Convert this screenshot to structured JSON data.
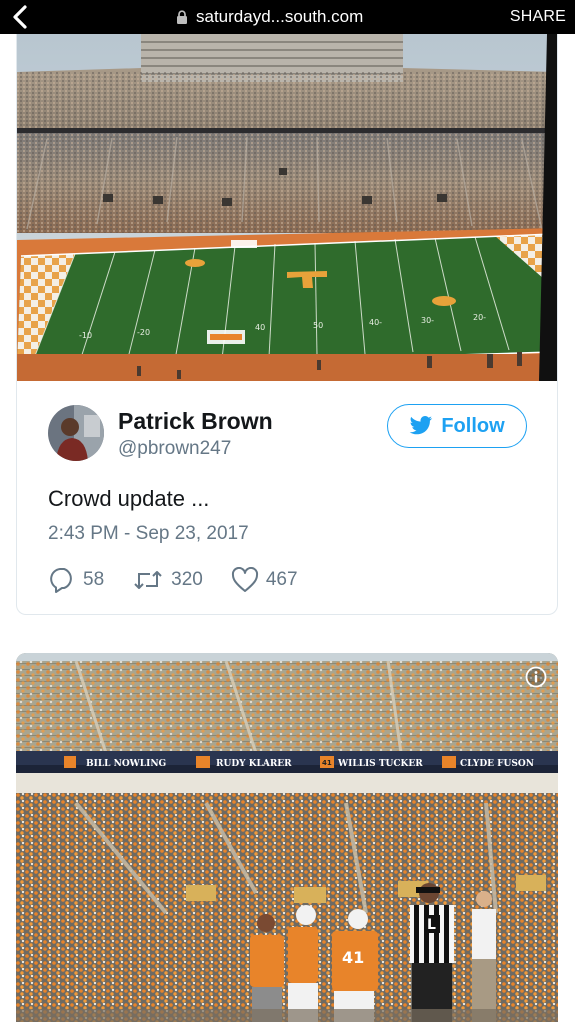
{
  "browser": {
    "url": "saturdayd...south.com",
    "share_label": "SHARE"
  },
  "tweet": {
    "user_name": "Patrick Brown",
    "user_handle": "@pbrown247",
    "follow_label": "Follow",
    "text": "Crowd update ...",
    "timestamp": "2:43 PM - Sep 23, 2017",
    "reply_count": "58",
    "retweet_count": "320",
    "like_count": "467"
  },
  "stadium_photo": {
    "yard_numbers": [
      "-10",
      "-20",
      "40",
      "50",
      "40-",
      "30-",
      "20-"
    ]
  },
  "crowd_photo": {
    "ring_of_honor": [
      {
        "number": "",
        "name": "BILL NOWLING"
      },
      {
        "number": "",
        "name": "RUDY KLARER"
      },
      {
        "number": "41",
        "name": "WILLIS TUCKER"
      },
      {
        "number": "",
        "name": "CLYDE FUSON"
      }
    ],
    "referee_letter": "L",
    "jersey_number": "41"
  },
  "colors": {
    "twitter_blue": "#1da1f2",
    "text_primary": "#14171a",
    "text_secondary": "#657786",
    "tennessee_orange": "#e8842a",
    "field_green": "#2f6b2c"
  }
}
